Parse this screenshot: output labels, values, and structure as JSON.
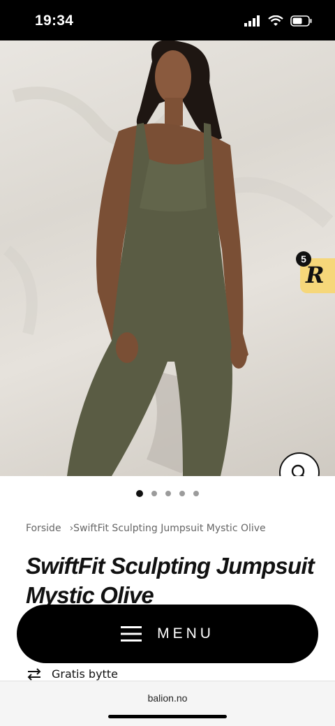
{
  "status_bar": {
    "time": "19:34",
    "icons": [
      "signal-icon",
      "wifi-icon",
      "battery-icon"
    ]
  },
  "hero": {
    "image_label": "product photo",
    "badge": {
      "letter": "R",
      "count": "5",
      "color": "#f6d77a"
    }
  },
  "carousel": {
    "total": 5,
    "active_index": 0
  },
  "breadcrumb": {
    "home": "Forside",
    "separator": "›",
    "current": "SwiftFit Sculpting Jumpsuit Mystic Olive"
  },
  "product": {
    "title": "SwiftFit Sculpting Jumpsuit Mystic Olive",
    "exchange_text": "Gratis bytte"
  },
  "menu_button": {
    "label": "MENU"
  },
  "browser": {
    "url": "balion.no"
  },
  "colors": {
    "accent": "#000000",
    "badge": "#f6d77a",
    "garment": "#5a5c44"
  }
}
